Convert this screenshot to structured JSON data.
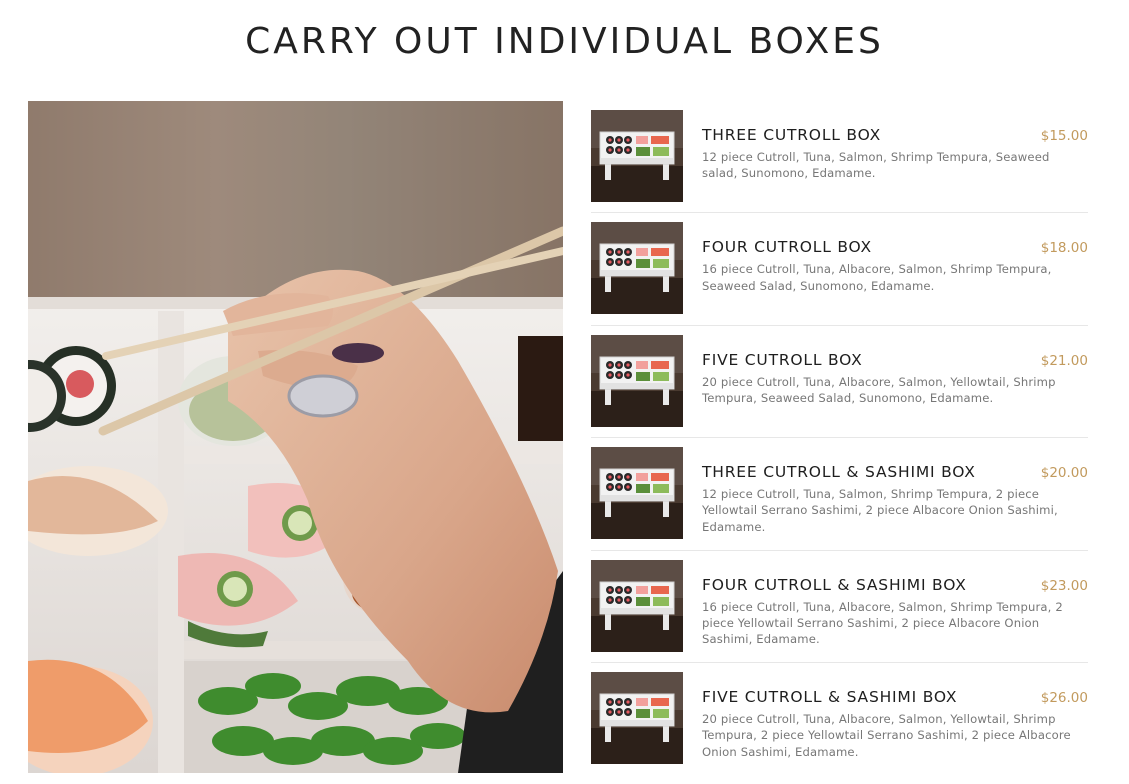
{
  "page": {
    "title": "CARRY OUT INDIVIDUAL BOXES"
  },
  "colors": {
    "price": "#c29a5d",
    "title": "#222222",
    "description": "#777777",
    "divider": "#e7e7e7"
  },
  "menu": {
    "items": [
      {
        "name": "THREE CUTROLL BOX",
        "price": "$15.00",
        "description": "12 piece Cutroll, Tuna, Salmon, Shrimp Tempura, Seaweed salad, Sunomono, Edamame."
      },
      {
        "name": "FOUR CUTROLL BOX",
        "price": "$18.00",
        "description": "16 piece Cutroll, Tuna, Albacore, Salmon, Shrimp Tempura, Seaweed Salad, Sunomono, Edamame."
      },
      {
        "name": "FIVE CUTROLL BOX",
        "price": "$21.00",
        "description": "20 piece Cutroll, Tuna, Albacore, Salmon, Yellowtail, Shrimp Tempura, Seaweed Salad, Sunomono, Edamame."
      },
      {
        "name": "THREE CUTROLL & SASHIMI BOX",
        "price": "$20.00",
        "description": "12 piece Cutroll, Tuna, Salmon, Shrimp Tempura, 2 piece Yellowtail Serrano Sashimi, 2 piece Albacore Onion Sashimi, Edamame."
      },
      {
        "name": "FOUR CUTROLL & SASHIMI BOX",
        "price": "$23.00",
        "description": "16 piece Cutroll, Tuna, Albacore, Salmon, Shrimp Tempura, 2 piece Yellowtail Serrano Sashimi, 2 piece Albacore Onion Sashimi, Edamame."
      },
      {
        "name": "FIVE CUTROLL & SASHIMI BOX",
        "price": "$26.00",
        "description": "20 piece Cutroll, Tuna, Albacore, Salmon, Yellowtail, Shrimp Tempura, 2 piece Yellowtail Serrano Sashimi, 2 piece Albacore Onion Sashimi, Edamame."
      }
    ]
  }
}
